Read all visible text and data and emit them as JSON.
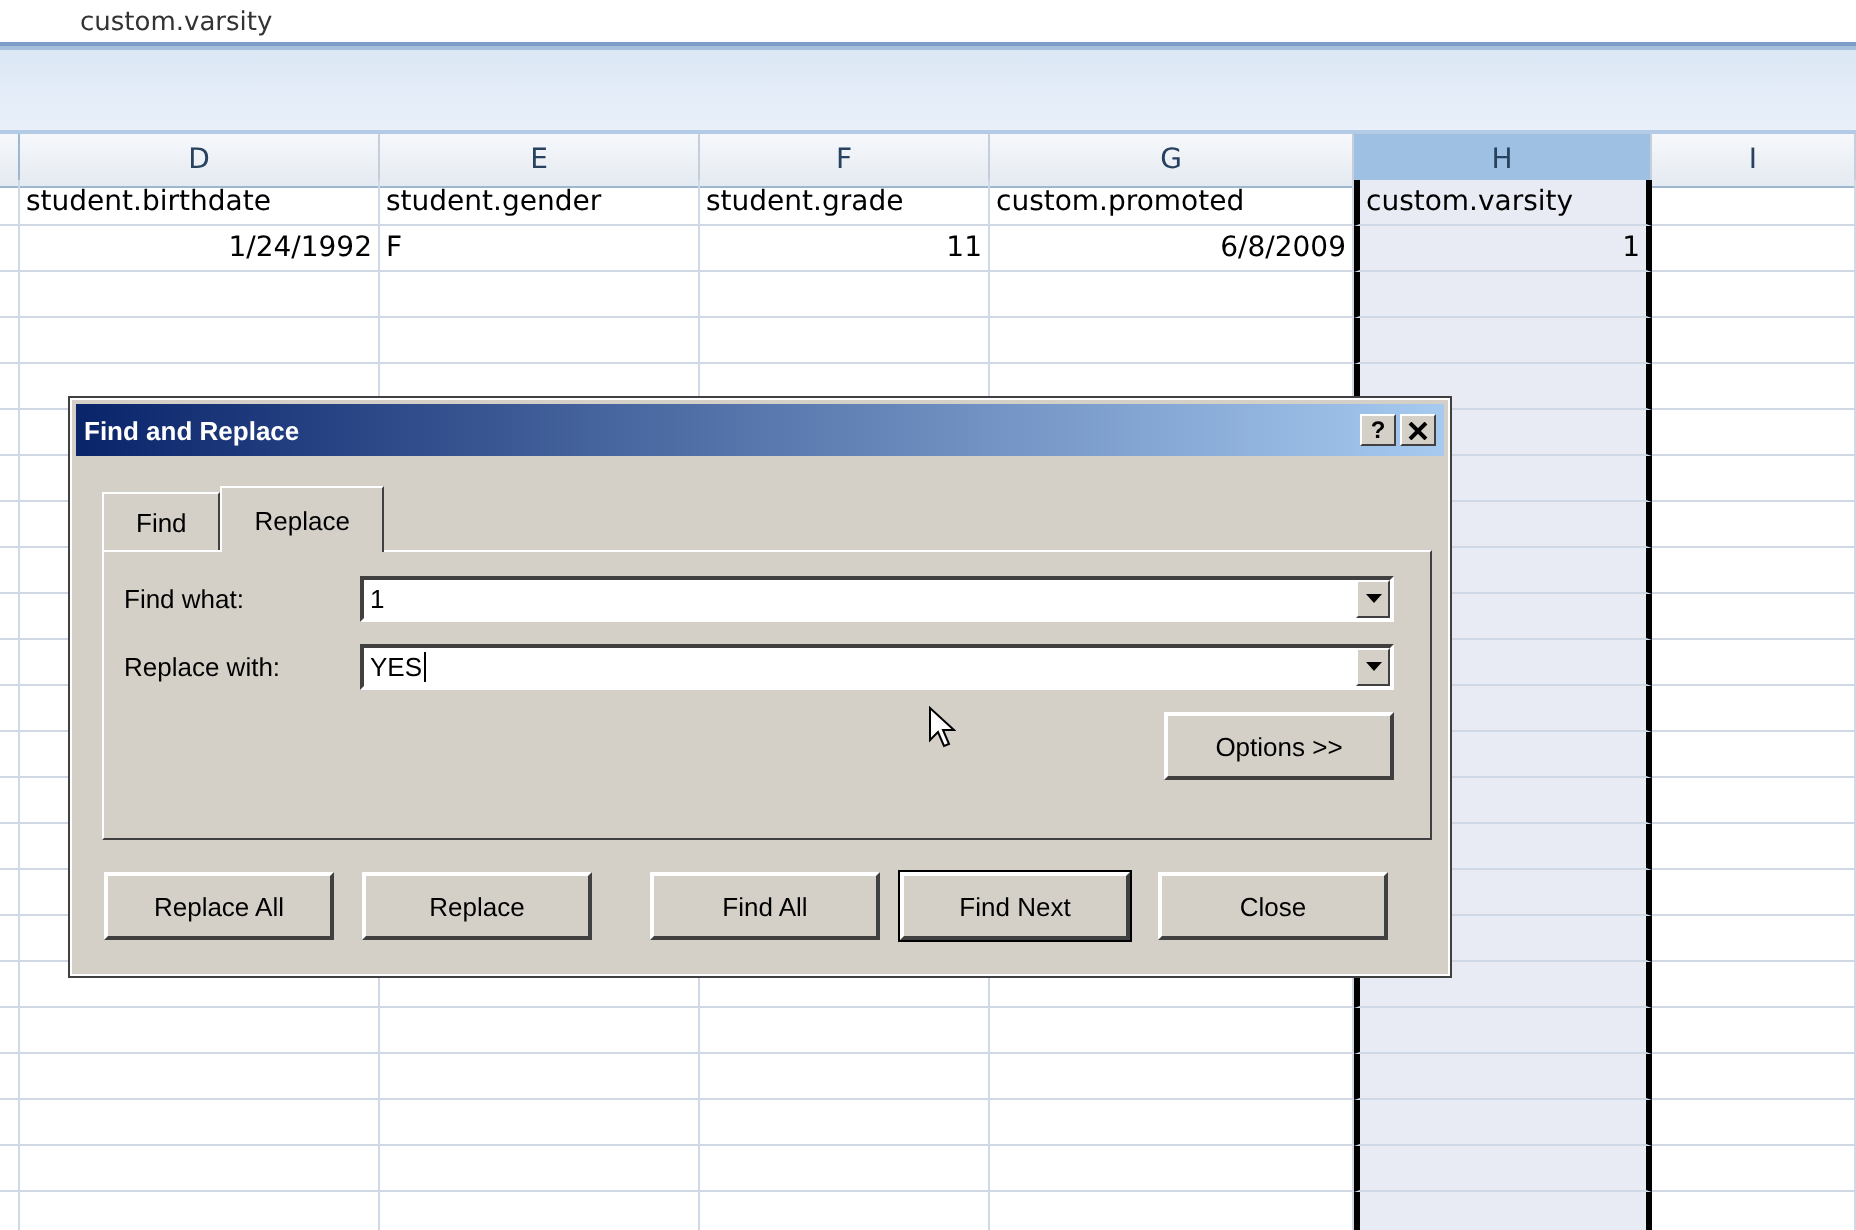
{
  "formula_bar": {
    "value": "custom.varsity"
  },
  "columns": [
    {
      "label": "D",
      "selected": false
    },
    {
      "label": "E",
      "selected": false
    },
    {
      "label": "F",
      "selected": false
    },
    {
      "label": "G",
      "selected": false
    },
    {
      "label": "H",
      "selected": true
    },
    {
      "label": "I",
      "selected": false
    }
  ],
  "rows": [
    {
      "cells": [
        {
          "text": "student.birthdate",
          "kind": "text"
        },
        {
          "text": "student.gender",
          "kind": "text"
        },
        {
          "text": "student.grade",
          "kind": "text"
        },
        {
          "text": "custom.promoted",
          "kind": "text"
        },
        {
          "text": "custom.varsity",
          "kind": "text"
        }
      ]
    },
    {
      "cells": [
        {
          "text": "1/24/1992",
          "kind": "number"
        },
        {
          "text": "F",
          "kind": "text"
        },
        {
          "text": "11",
          "kind": "number"
        },
        {
          "text": "6/8/2009",
          "kind": "number"
        },
        {
          "text": "1",
          "kind": "number"
        }
      ]
    }
  ],
  "dialog": {
    "title": "Find and Replace",
    "help": "?",
    "tabs": [
      {
        "label": "Find",
        "selected": false
      },
      {
        "label": "Replace",
        "selected": true
      }
    ],
    "fields": [
      {
        "label": "Find what:",
        "value": "1",
        "focused": false
      },
      {
        "label": "Replace with:",
        "value": "YES",
        "focused": true
      }
    ],
    "options_button": "Options >>",
    "buttons": [
      {
        "label": "Replace All",
        "default": false
      },
      {
        "label": "Replace",
        "default": false
      },
      {
        "label": "Find All",
        "default": false
      },
      {
        "label": "Find Next",
        "default": true
      },
      {
        "label": "Close",
        "default": false
      }
    ]
  }
}
